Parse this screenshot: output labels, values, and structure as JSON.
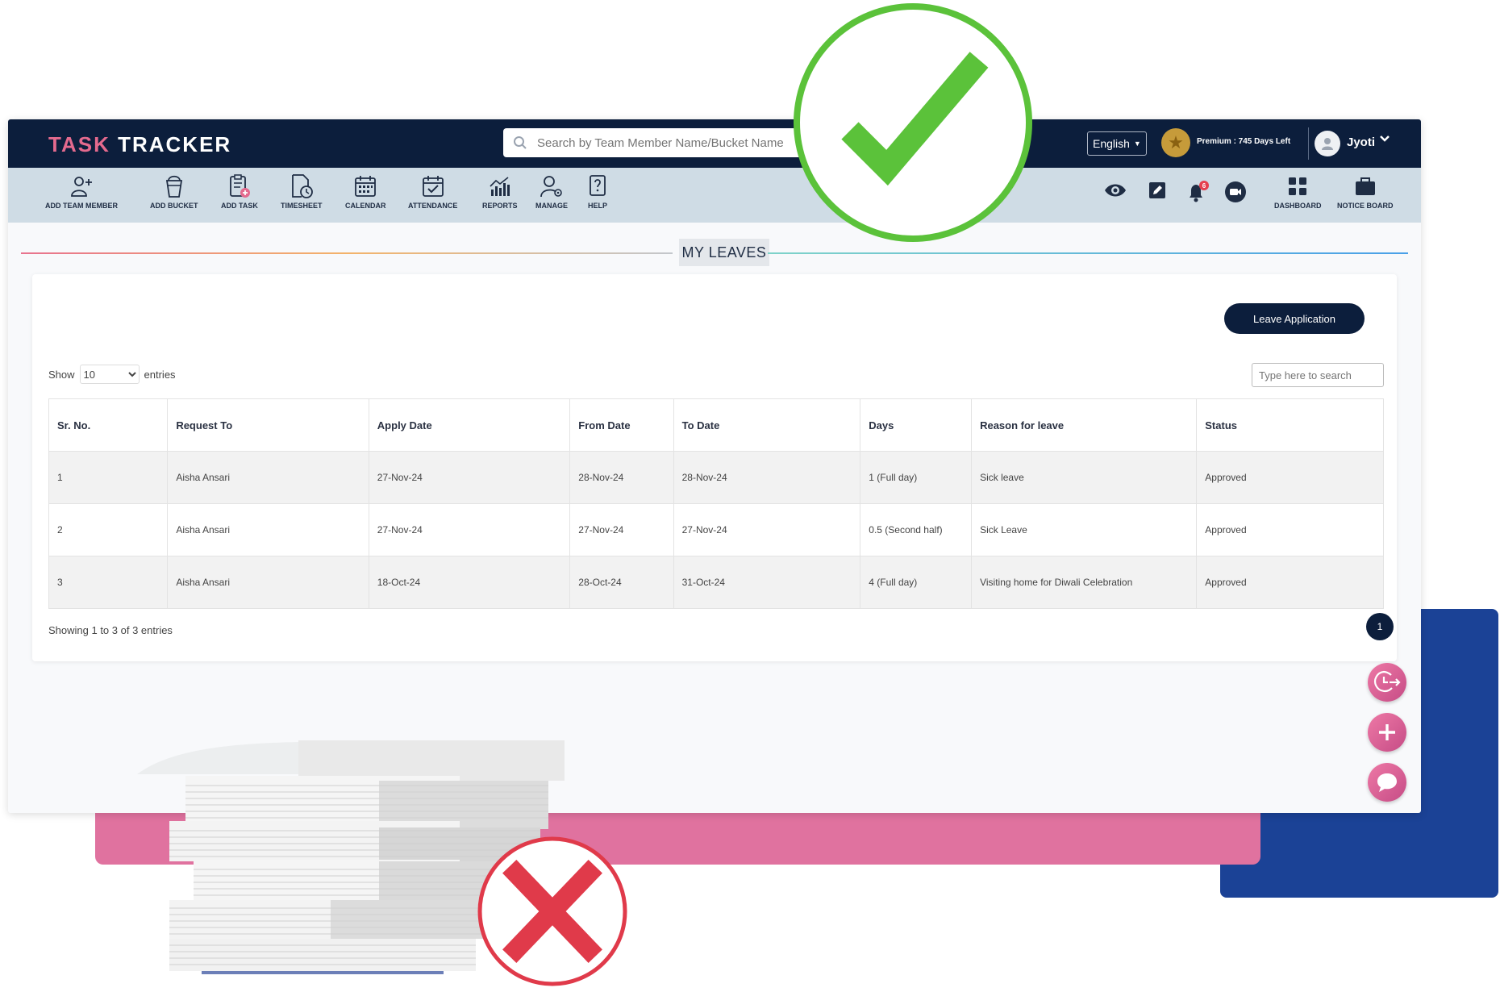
{
  "header": {
    "logo": {
      "part1": "TASK",
      "part2": "TRACKER"
    },
    "search_placeholder": "Search by Team Member Name/Bucket Name",
    "language": "English",
    "premium": "Premium : 745 Days Left",
    "user": "Jyoti"
  },
  "toolbar": {
    "left_items": [
      {
        "label": "ADD TEAM MEMBER",
        "icon": "add-user-icon"
      },
      {
        "label": "ADD BUCKET",
        "icon": "bucket-icon"
      },
      {
        "label": "ADD TASK",
        "icon": "clipboard-add-icon"
      },
      {
        "label": "TIMESHEET",
        "icon": "timesheet-icon"
      },
      {
        "label": "CALENDAR",
        "icon": "calendar-icon"
      },
      {
        "label": "ATTENDANCE",
        "icon": "attendance-icon"
      },
      {
        "label": "REPORTS",
        "icon": "reports-icon"
      },
      {
        "label": "MANAGE",
        "icon": "manage-user-icon"
      },
      {
        "label": "HELP",
        "icon": "help-icon"
      }
    ],
    "right_icons": [
      "eye-icon",
      "edit-icon",
      "bell-icon",
      "video-icon"
    ],
    "notification_count": "6",
    "right_items": [
      {
        "label": "DASHBOARD",
        "icon": "dashboard-icon"
      },
      {
        "label": "NOTICE BOARD",
        "icon": "briefcase-icon"
      }
    ]
  },
  "page": {
    "title": "MY LEAVES",
    "leave_button": "Leave Application",
    "length": {
      "show": "Show",
      "value": "10",
      "entries": "entries"
    },
    "search_placeholder": "Type here to search",
    "info": "Showing 1 to 3 of 3 entries",
    "current_page": "1"
  },
  "table": {
    "columns": [
      "Sr. No.",
      "Request To",
      "Apply Date",
      "From Date",
      "To Date",
      "Days",
      "Reason for leave",
      "Status"
    ],
    "rows": [
      [
        "1",
        "Aisha Ansari",
        "27-Nov-24",
        "28-Nov-24",
        "28-Nov-24",
        "1 (Full day)",
        "Sick leave",
        "Approved"
      ],
      [
        "2",
        "Aisha Ansari",
        "27-Nov-24",
        "27-Nov-24",
        "27-Nov-24",
        "0.5 (Second half)",
        "Sick Leave",
        "Approved"
      ],
      [
        "3",
        "Aisha Ansari",
        "18-Oct-24",
        "28-Oct-24",
        "31-Oct-24",
        "4 (Full day)",
        "Visiting home for Diwali Celebration",
        "Approved"
      ]
    ]
  },
  "floating_buttons": [
    "clock-out-icon",
    "plus-icon",
    "chat-icon"
  ],
  "colors": {
    "navy": "#0c1e3c",
    "toolbar": "#cfdce5",
    "pink": "#e0729f",
    "blue": "#1b4296",
    "check_green": "#5bc23a",
    "cross_red": "#e03a4a"
  }
}
